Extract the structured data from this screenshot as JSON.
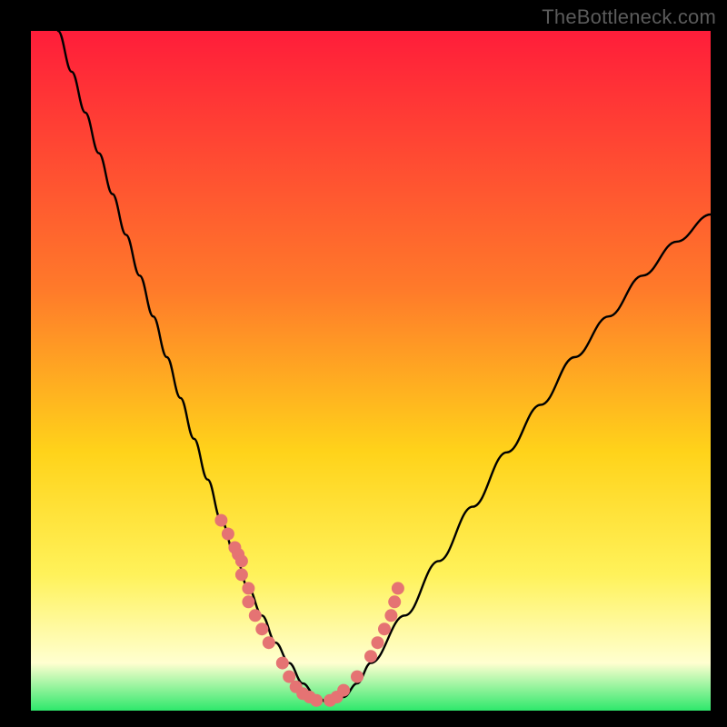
{
  "watermark": "TheBottleneck.com",
  "colors": {
    "frame": "#000000",
    "curve": "#000000",
    "markers": "#e57373",
    "gradient_top": "#ff1d3a",
    "gradient_mid1": "#ff7a2a",
    "gradient_mid2": "#ffd31a",
    "gradient_low1": "#fff25a",
    "gradient_low2": "#ffffd0",
    "gradient_base": "#2ee86b"
  },
  "chart_data": {
    "type": "line",
    "title": "",
    "xlabel": "",
    "ylabel": "",
    "xlim": [
      0,
      100
    ],
    "ylim": [
      0,
      100
    ],
    "series": [
      {
        "name": "bottleneck-curve",
        "x": [
          4,
          6,
          8,
          10,
          12,
          14,
          16,
          18,
          20,
          22,
          24,
          26,
          28,
          30,
          32,
          34,
          36,
          38,
          40,
          42,
          44,
          46,
          48,
          50,
          55,
          60,
          65,
          70,
          75,
          80,
          85,
          90,
          95,
          100
        ],
        "y": [
          100,
          94,
          88,
          82,
          76,
          70,
          64,
          58,
          52,
          46,
          40,
          34,
          28,
          23,
          18,
          14,
          10,
          7,
          4,
          2,
          1,
          2,
          4,
          7,
          14,
          22,
          30,
          38,
          45,
          52,
          58,
          64,
          69,
          73
        ]
      }
    ],
    "markers": {
      "name": "highlight-points",
      "x": [
        28,
        29,
        30,
        30.5,
        31,
        31,
        32,
        32,
        33,
        34,
        35,
        37,
        38,
        39,
        40,
        41,
        42,
        44,
        45,
        46,
        48,
        50,
        51,
        52,
        53,
        53.5,
        54
      ],
      "y": [
        28,
        26,
        24,
        23,
        22,
        20,
        18,
        16,
        14,
        12,
        10,
        7,
        5,
        3.5,
        2.5,
        2,
        1.5,
        1.5,
        2,
        3,
        5,
        8,
        10,
        12,
        14,
        16,
        18
      ]
    }
  }
}
